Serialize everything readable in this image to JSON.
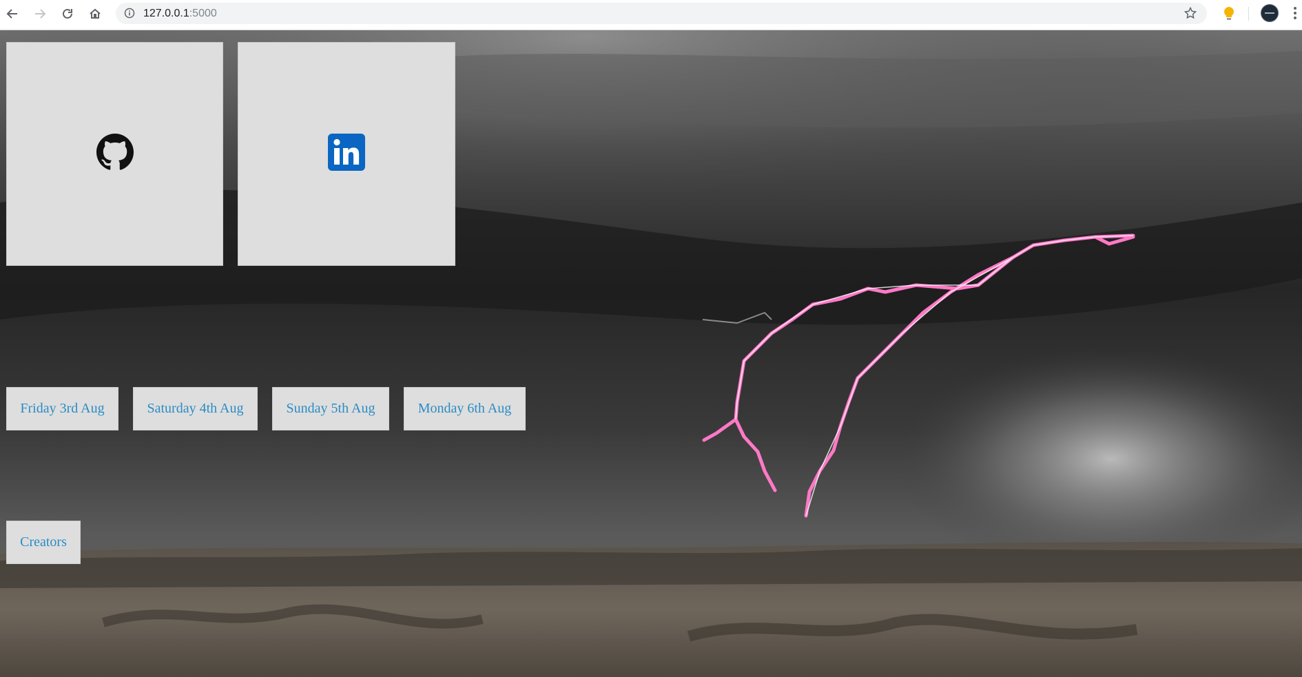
{
  "browser": {
    "url_host": "127.0.0.1",
    "url_port": ":5000"
  },
  "links": {
    "github_icon": "github-icon",
    "linkedin_icon": "linkedin-icon"
  },
  "days": [
    {
      "label": "Friday 3rd Aug"
    },
    {
      "label": "Saturday 4th Aug"
    },
    {
      "label": "Sunday 5th Aug"
    },
    {
      "label": "Monday 6th Aug"
    }
  ],
  "creators_label": "Creators",
  "colors": {
    "tile_bg": "#dedede",
    "link_text": "#2b8cc4",
    "linkedin_blue": "#0a66c2"
  }
}
